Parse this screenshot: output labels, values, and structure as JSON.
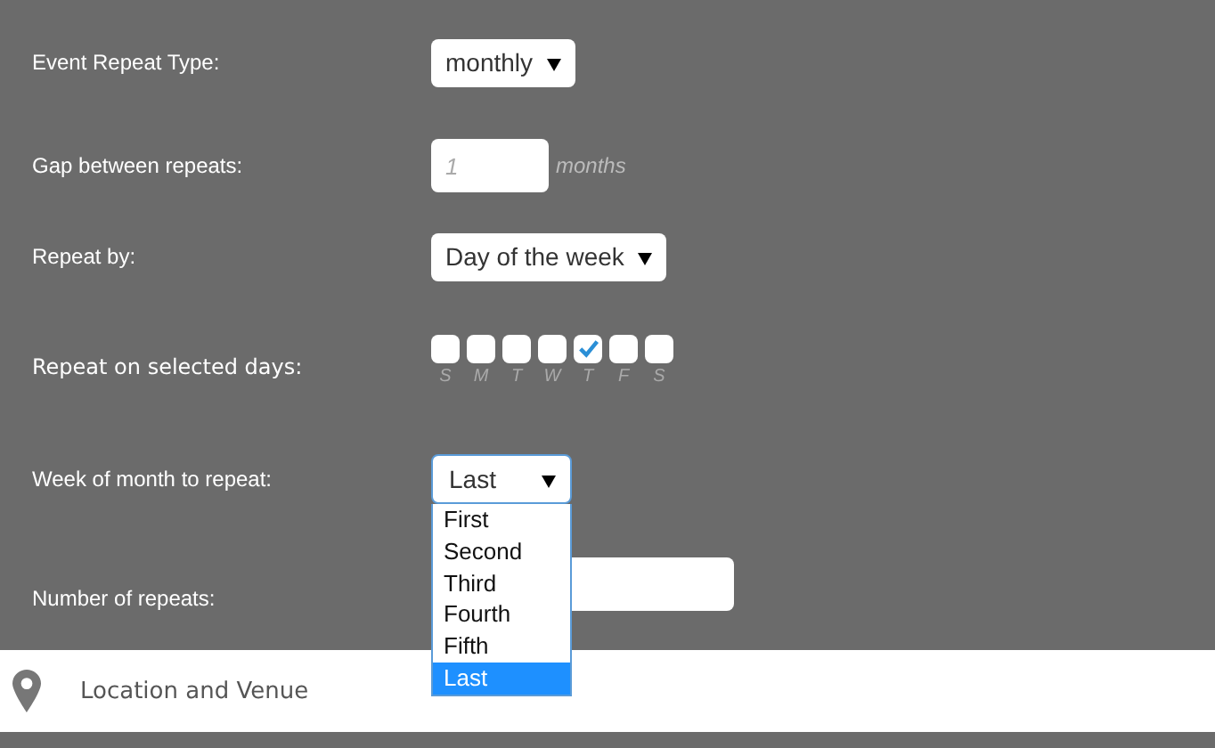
{
  "fields": [
    {
      "kind": "select",
      "label": "Event Repeat Type:",
      "value": "monthly"
    },
    {
      "kind": "number",
      "label": "Gap between repeats:",
      "placeholder": "1",
      "unit": "months"
    },
    {
      "kind": "select",
      "label": "Repeat by:",
      "value": "Day of the week"
    },
    {
      "kind": "days",
      "label": "Repeat on selected days:",
      "days": [
        {
          "letter": "S",
          "checked": false
        },
        {
          "letter": "M",
          "checked": false
        },
        {
          "letter": "T",
          "checked": false
        },
        {
          "letter": "W",
          "checked": false
        },
        {
          "letter": "T",
          "checked": true
        },
        {
          "letter": "F",
          "checked": false
        },
        {
          "letter": "S",
          "checked": false
        }
      ]
    },
    {
      "kind": "open-select",
      "label": "Week of month to repeat:",
      "value": "Last",
      "options": [
        {
          "label": "First",
          "selected": false
        },
        {
          "label": "Second",
          "selected": false
        },
        {
          "label": "Third",
          "selected": false
        },
        {
          "label": "Fourth",
          "selected": false
        },
        {
          "label": "Fifth",
          "selected": false
        },
        {
          "label": "Last",
          "selected": true
        }
      ]
    },
    {
      "kind": "text",
      "label": "Number of repeats:"
    }
  ],
  "section": {
    "title": "Location and Venue"
  }
}
